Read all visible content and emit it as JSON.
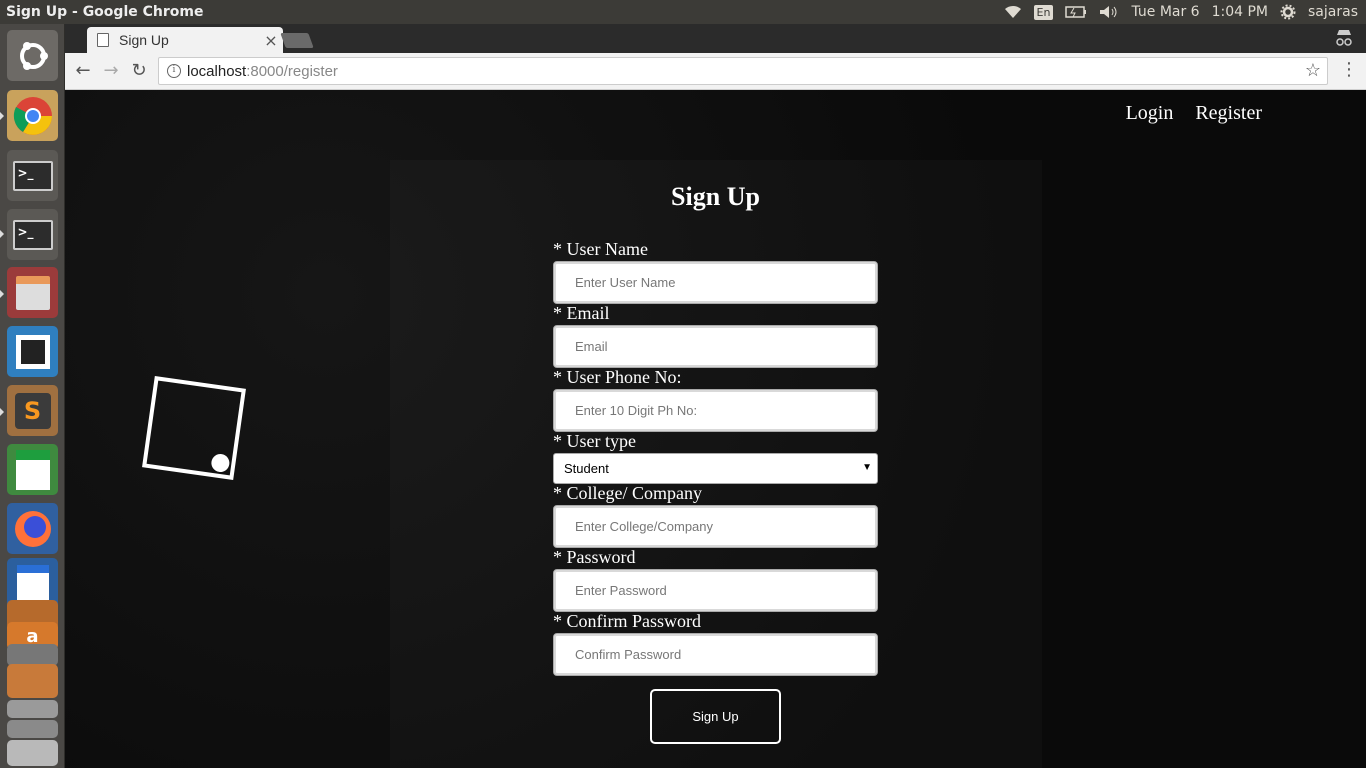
{
  "os_panel": {
    "window_title": "Sign Up - Google Chrome",
    "keyboard": "En",
    "datetime": "Tue Mar  6",
    "time": "1:04 PM",
    "user": "sajaras"
  },
  "launcher": {
    "items": [
      "ubuntu-dash",
      "chrome",
      "terminal",
      "terminal",
      "files",
      "app-store-box",
      "sublime-text",
      "libreoffice-calc",
      "firefox",
      "libreoffice-writer",
      "libreoffice-impress",
      "amazon",
      "text-editor",
      "trash"
    ]
  },
  "browser": {
    "tab_title": "Sign Up",
    "tab_close": "×",
    "url_host": "localhost",
    "url_path": ":8000/register"
  },
  "page": {
    "nav": {
      "login": "Login",
      "register": "Register"
    },
    "title": "Sign Up",
    "fields": [
      {
        "label": "* User Name",
        "placeholder": "Enter User Name"
      },
      {
        "label": "* Email",
        "placeholder": "Email"
      },
      {
        "label": "* User Phone No:",
        "placeholder": "Enter 10 Digit Ph No:"
      },
      {
        "label": "* User type",
        "value": "Student"
      },
      {
        "label": "* College/ Company",
        "placeholder": "Enter College/Company"
      },
      {
        "label": "* Password",
        "placeholder": "Enter Password"
      },
      {
        "label": "* Confirm Password",
        "placeholder": "Confirm Password"
      }
    ],
    "submit_label": "Sign Up"
  }
}
